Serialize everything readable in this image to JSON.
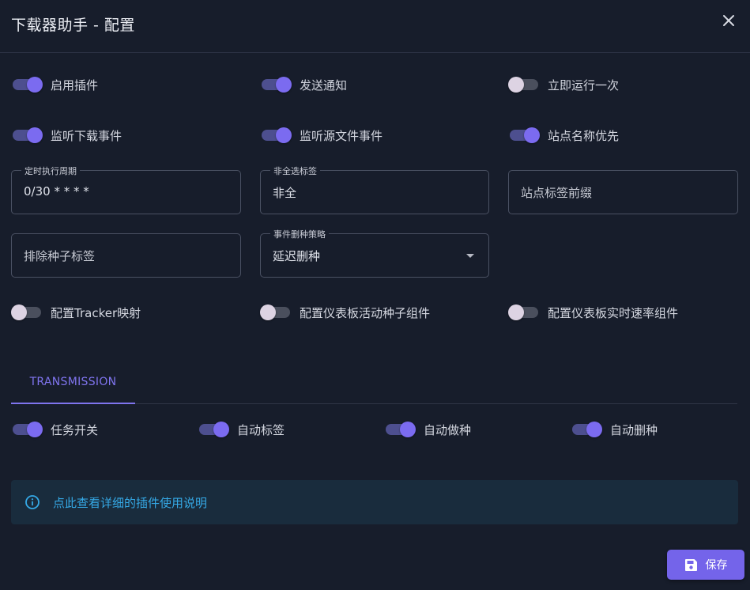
{
  "dialog": {
    "title": "下载器助手 - 配置"
  },
  "switches_row1": [
    {
      "label": "启用插件",
      "on": true
    },
    {
      "label": "发送通知",
      "on": true
    },
    {
      "label": "立即运行一次",
      "on": false
    }
  ],
  "switches_row2": [
    {
      "label": "监听下载事件",
      "on": true
    },
    {
      "label": "监听源文件事件",
      "on": true
    },
    {
      "label": "站点名称优先",
      "on": true
    }
  ],
  "fields": {
    "cron": {
      "label": "定时执行周期",
      "value": "0/30 * * * *"
    },
    "non_seed_tag": {
      "label": "非全选标签",
      "value": "非全"
    },
    "site_tag_prefix": {
      "placeholder": "站点标签前缀"
    },
    "exclude_tags": {
      "placeholder": "排除种子标签"
    },
    "delete_strategy": {
      "label": "事件删种策略",
      "value": "延迟删种"
    }
  },
  "switches_row3": [
    {
      "label": "配置Tracker映射",
      "on": false
    },
    {
      "label": "配置仪表板活动种子组件",
      "on": false
    },
    {
      "label": "配置仪表板实时速率组件",
      "on": false
    }
  ],
  "tabs": [
    {
      "label": "TRANSMISSION",
      "active": true
    }
  ],
  "task_switches": [
    {
      "label": "任务开关",
      "on": true
    },
    {
      "label": "自动标签",
      "on": true
    },
    {
      "label": "自动做种",
      "on": true
    },
    {
      "label": "自动删种",
      "on": true
    }
  ],
  "info": {
    "text": "点此查看详细的插件使用说明",
    "icon": "info-circle-icon"
  },
  "save_button": {
    "label": "保存",
    "icon": "floppy-disk-icon"
  },
  "colors": {
    "background": "#171d2b",
    "accent": "#7464ea",
    "info_text": "#35a9e6"
  }
}
